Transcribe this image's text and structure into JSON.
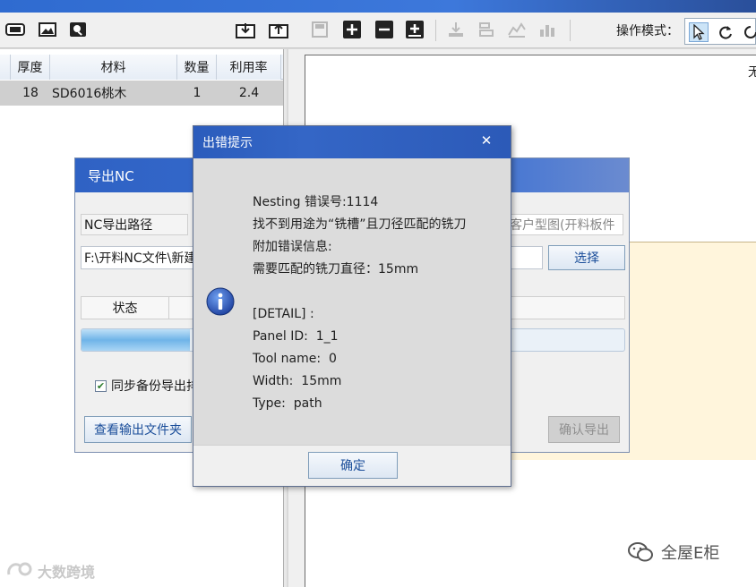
{
  "toolbar": {
    "mode_label": "操作模式："
  },
  "parts_grid": {
    "columns": [
      "厚度",
      "材料",
      "数量",
      "利用率"
    ],
    "rows": [
      {
        "thickness": "18",
        "material": "SD6016桃木",
        "quantity": "1",
        "utilization": "2.4"
      }
    ]
  },
  "canvas": {
    "corner_text": "无"
  },
  "export_nc_dialog": {
    "title": "导出NC",
    "path_label": "NC导出路径",
    "target_text": "客户型图(开料板件",
    "path_value": "F:\\开料NC文件\\新建",
    "choose_button": "选择",
    "status_header": "状态",
    "progress": 0.2,
    "sync_backup_label": "同步备份导出排",
    "sync_backup_checked": true,
    "view_folder_button": "查看输出文件夹",
    "confirm_export_button": "确认导出"
  },
  "error_dialog": {
    "title": "出错提示",
    "close_glyph": "✕",
    "lines": [
      "Nesting 错误号:1114",
      "找不到用途为“铣槽”且刀径匹配的铣刀",
      "附加错误信息:",
      "需要匹配的铣刀直径：15mm",
      "",
      "[DETAIL] :",
      "Panel ID:  1_1",
      "Tool name:  0",
      "Width:  15mm",
      "Type:  path"
    ],
    "ok_button": "确定"
  },
  "watermarks": {
    "left": "大数跨境",
    "right": "全屋E柜"
  }
}
